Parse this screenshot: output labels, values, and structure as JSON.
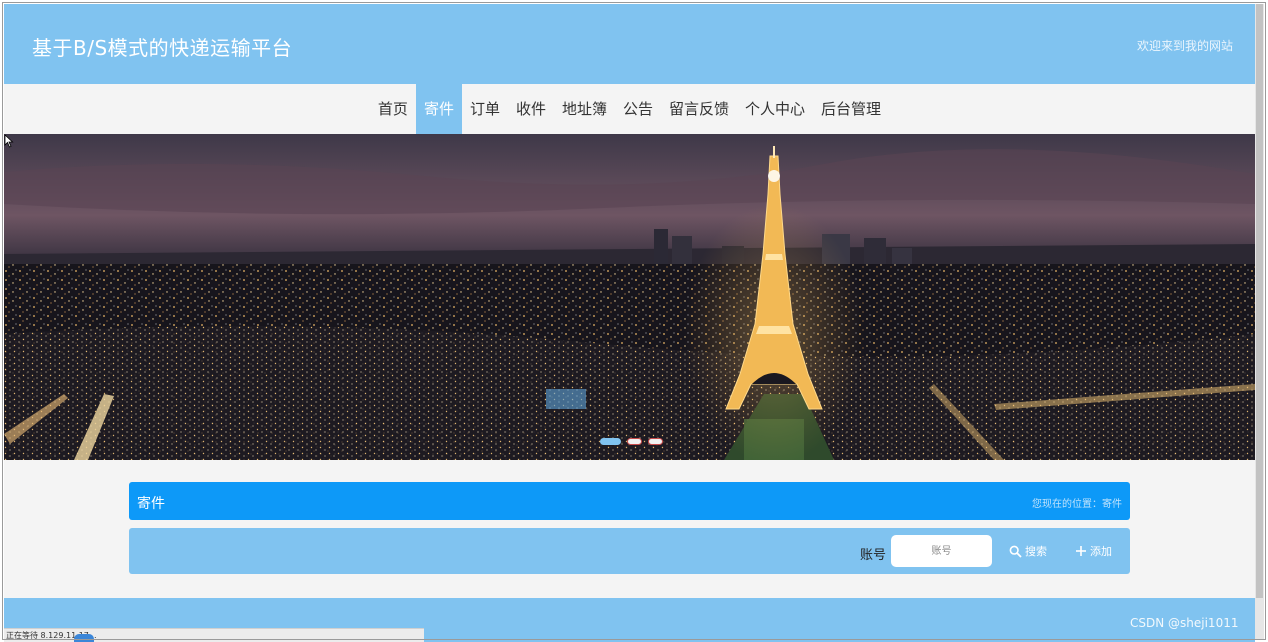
{
  "header": {
    "site_title": "基于B/S模式的快递运输平台",
    "welcome": "欢迎来到我的网站"
  },
  "nav": {
    "items": [
      "首页",
      "寄件",
      "订单",
      "收件",
      "地址簿",
      "公告",
      "留言反馈",
      "个人中心",
      "后台管理"
    ],
    "active": "寄件"
  },
  "banner": {
    "slides": 3,
    "active_slide": 1
  },
  "section": {
    "title": "寄件",
    "breadcrumb": "您现在的位置：寄件"
  },
  "search": {
    "account_label": "账号",
    "account_placeholder": "账号",
    "search_label": "搜索",
    "add_label": "添加"
  },
  "status_bar": "正在等待 8.129.11.17...",
  "watermark": "CSDN @sheji1011",
  "colors": {
    "header": "#80c3f0",
    "section_bar": "#0d99f8",
    "background": "#f4f4f4"
  },
  "icons": {
    "search": "magnifier-icon",
    "add": "plus-icon"
  }
}
